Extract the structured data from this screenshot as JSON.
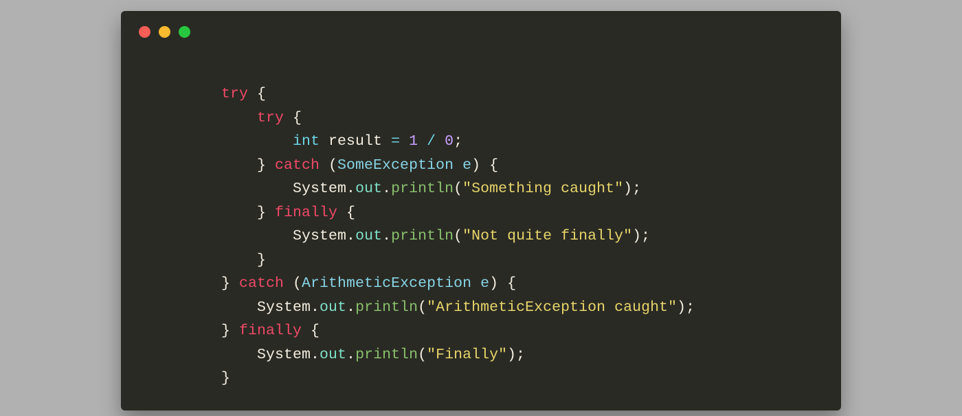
{
  "tokens": [
    [
      {
        "t": "try",
        "c": "kw"
      },
      {
        "t": " {",
        "c": "pun"
      }
    ],
    [
      {
        "t": "    ",
        "c": "pun"
      },
      {
        "t": "try",
        "c": "kw"
      },
      {
        "t": " {",
        "c": "pun"
      }
    ],
    [
      {
        "t": "        ",
        "c": "pun"
      },
      {
        "t": "int",
        "c": "type"
      },
      {
        "t": " result ",
        "c": "pun"
      },
      {
        "t": "=",
        "c": "eq"
      },
      {
        "t": " ",
        "c": "pun"
      },
      {
        "t": "1",
        "c": "num"
      },
      {
        "t": " ",
        "c": "pun"
      },
      {
        "t": "/",
        "c": "eq"
      },
      {
        "t": " ",
        "c": "pun"
      },
      {
        "t": "0",
        "c": "num"
      },
      {
        "t": ";",
        "c": "pun"
      }
    ],
    [
      {
        "t": "    } ",
        "c": "pun"
      },
      {
        "t": "catch",
        "c": "kw"
      },
      {
        "t": " (",
        "c": "pun"
      },
      {
        "t": "SomeException",
        "c": "cls"
      },
      {
        "t": " ",
        "c": "pun"
      },
      {
        "t": "e",
        "c": "cls"
      },
      {
        "t": ") {",
        "c": "pun"
      }
    ],
    [
      {
        "t": "        ",
        "c": "pun"
      },
      {
        "t": "System",
        "c": "call"
      },
      {
        "t": ".",
        "c": "pun"
      },
      {
        "t": "out",
        "c": "prop"
      },
      {
        "t": ".",
        "c": "pun"
      },
      {
        "t": "println",
        "c": "fn"
      },
      {
        "t": "(",
        "c": "pun"
      },
      {
        "t": "\"Something caught\"",
        "c": "str"
      },
      {
        "t": ");",
        "c": "pun"
      }
    ],
    [
      {
        "t": "    } ",
        "c": "pun"
      },
      {
        "t": "finally",
        "c": "kw"
      },
      {
        "t": " {",
        "c": "pun"
      }
    ],
    [
      {
        "t": "        ",
        "c": "pun"
      },
      {
        "t": "System",
        "c": "call"
      },
      {
        "t": ".",
        "c": "pun"
      },
      {
        "t": "out",
        "c": "prop"
      },
      {
        "t": ".",
        "c": "pun"
      },
      {
        "t": "println",
        "c": "fn"
      },
      {
        "t": "(",
        "c": "pun"
      },
      {
        "t": "\"Not quite finally\"",
        "c": "str"
      },
      {
        "t": ");",
        "c": "pun"
      }
    ],
    [
      {
        "t": "    }",
        "c": "pun"
      }
    ],
    [
      {
        "t": "} ",
        "c": "pun"
      },
      {
        "t": "catch",
        "c": "kw"
      },
      {
        "t": " (",
        "c": "pun"
      },
      {
        "t": "ArithmeticException",
        "c": "cls"
      },
      {
        "t": " ",
        "c": "pun"
      },
      {
        "t": "e",
        "c": "cls"
      },
      {
        "t": ") {",
        "c": "pun"
      }
    ],
    [
      {
        "t": "    ",
        "c": "pun"
      },
      {
        "t": "System",
        "c": "call"
      },
      {
        "t": ".",
        "c": "pun"
      },
      {
        "t": "out",
        "c": "prop"
      },
      {
        "t": ".",
        "c": "pun"
      },
      {
        "t": "println",
        "c": "fn"
      },
      {
        "t": "(",
        "c": "pun"
      },
      {
        "t": "\"ArithmeticException caught\"",
        "c": "str"
      },
      {
        "t": ");",
        "c": "pun"
      }
    ],
    [
      {
        "t": "} ",
        "c": "pun"
      },
      {
        "t": "finally",
        "c": "kw"
      },
      {
        "t": " {",
        "c": "pun"
      }
    ],
    [
      {
        "t": "    ",
        "c": "pun"
      },
      {
        "t": "System",
        "c": "call"
      },
      {
        "t": ".",
        "c": "pun"
      },
      {
        "t": "out",
        "c": "prop"
      },
      {
        "t": ".",
        "c": "pun"
      },
      {
        "t": "println",
        "c": "fn"
      },
      {
        "t": "(",
        "c": "pun"
      },
      {
        "t": "\"Finally\"",
        "c": "str"
      },
      {
        "t": ");",
        "c": "pun"
      }
    ],
    [
      {
        "t": "}",
        "c": "pun"
      }
    ]
  ]
}
